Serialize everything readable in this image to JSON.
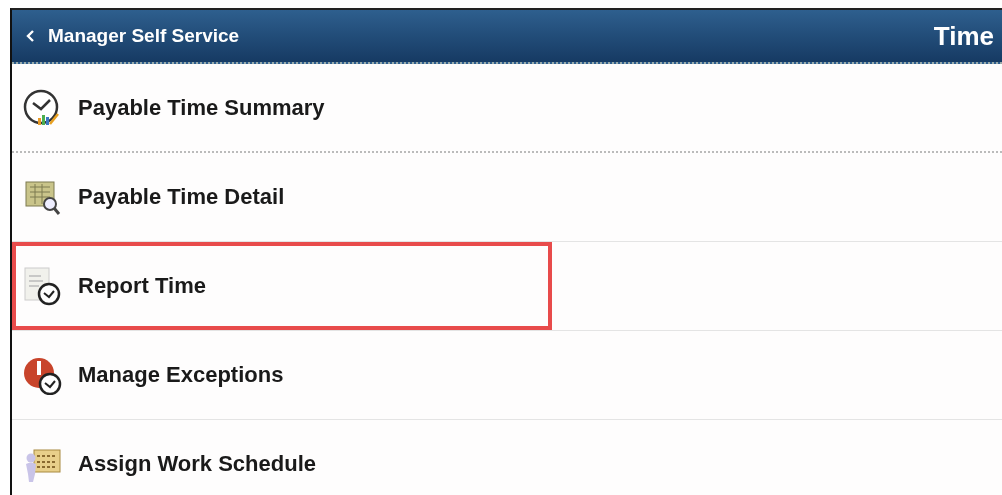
{
  "header": {
    "back_label": "Manager Self Service",
    "title": "Time"
  },
  "items": [
    {
      "label": "Payable Time Summary",
      "kind": "chart-clock",
      "highlighted": false
    },
    {
      "label": "Payable Time Detail",
      "kind": "grid-magnifier",
      "highlighted": false
    },
    {
      "label": "Report Time",
      "kind": "document-clock",
      "highlighted": true
    },
    {
      "label": "Manage Exceptions",
      "kind": "alert-clock",
      "highlighted": false
    },
    {
      "label": "Assign Work Schedule",
      "kind": "person-schedule",
      "highlighted": false
    }
  ]
}
